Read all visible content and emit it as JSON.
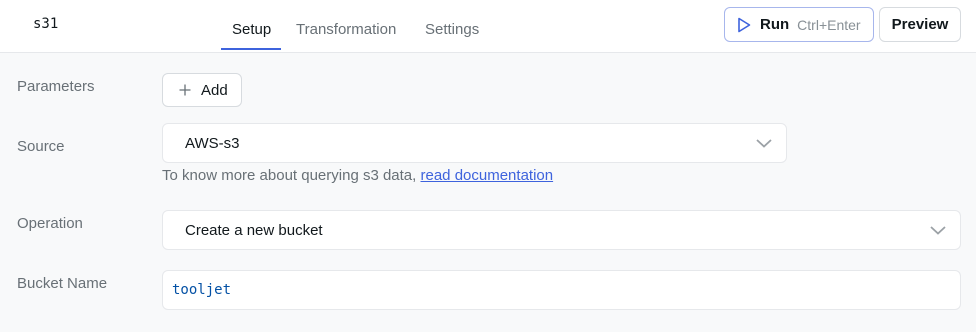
{
  "header": {
    "query_name": "s31",
    "tabs": [
      {
        "label": "Setup"
      },
      {
        "label": "Transformation"
      },
      {
        "label": "Settings"
      }
    ],
    "run_label": "Run",
    "run_shortcut": "Ctrl+Enter",
    "preview_label": "Preview"
  },
  "form": {
    "parameters_label": "Parameters",
    "add_label": "Add",
    "source_label": "Source",
    "source_value": "AWS-s3",
    "helper_text": "To know more about querying s3 data,",
    "helper_link": "read documentation",
    "operation_label": "Operation",
    "operation_value": "Create a new bucket",
    "bucket_name_label": "Bucket Name",
    "bucket_name_value": "tooljet"
  },
  "colors": {
    "accent": "#3e63dd",
    "background": "#f8f9fa",
    "muted_text": "#687076",
    "code_text": "#0451a5"
  },
  "icons": {
    "run": "play-icon",
    "add": "plus-icon",
    "select": "chevron-down-icon"
  }
}
